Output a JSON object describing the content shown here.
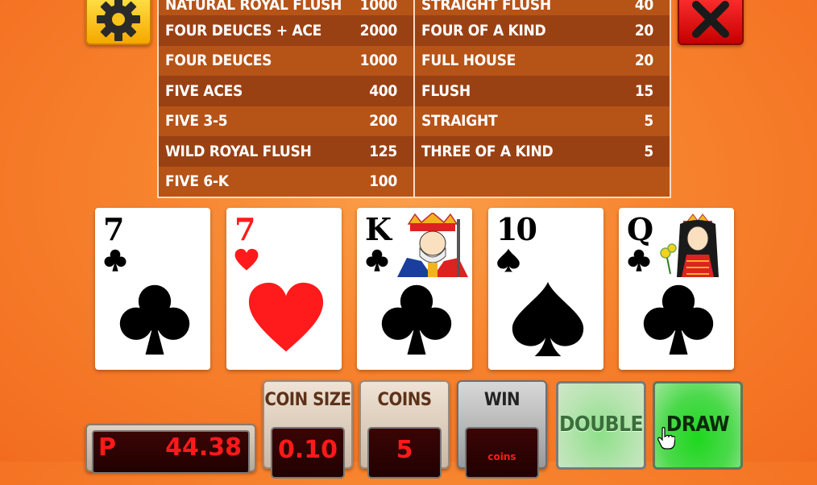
{
  "paytable": {
    "left": [
      {
        "hand": "NATURAL ROYAL FLUSH",
        "pay": "1000"
      },
      {
        "hand": "FOUR DEUCES + ACE",
        "pay": "2000"
      },
      {
        "hand": "FOUR DEUCES",
        "pay": "1000"
      },
      {
        "hand": "FIVE ACES",
        "pay": "400"
      },
      {
        "hand": "FIVE 3-5",
        "pay": "200"
      },
      {
        "hand": "WILD ROYAL FLUSH",
        "pay": "125"
      },
      {
        "hand": "FIVE 6-K",
        "pay": "100"
      }
    ],
    "right": [
      {
        "hand": "STRAIGHT FLUSH",
        "pay": "40"
      },
      {
        "hand": "FOUR OF A KIND",
        "pay": "20"
      },
      {
        "hand": "FULL HOUSE",
        "pay": "20"
      },
      {
        "hand": "FLUSH",
        "pay": "15"
      },
      {
        "hand": "STRAIGHT",
        "pay": "5"
      },
      {
        "hand": "THREE OF A KIND",
        "pay": "5"
      },
      {
        "hand": "",
        "pay": ""
      }
    ]
  },
  "cards": [
    {
      "rank": "7",
      "suit": "clubs",
      "color": "black"
    },
    {
      "rank": "7",
      "suit": "hearts",
      "color": "red"
    },
    {
      "rank": "K",
      "suit": "clubs",
      "color": "black"
    },
    {
      "rank": "10",
      "suit": "spades",
      "color": "black"
    },
    {
      "rank": "Q",
      "suit": "clubs",
      "color": "black"
    }
  ],
  "controls": {
    "credits_prefix": "P",
    "credits_value": "44.38",
    "coin_size_label": "COIN SIZE",
    "coin_size_value": "0.10",
    "coins_label": "COINS",
    "coins_value": "5",
    "win_label": "WIN",
    "win_value": "coins",
    "double_label": "DOUBLE",
    "draw_label": "DRAW"
  },
  "colors": {
    "background": "#f7832e",
    "table_row_light": "#b65317",
    "table_row_dark": "#9a4114",
    "led_red": "#ff1a1a",
    "draw_green": "#2fd42f"
  },
  "icons": {
    "settings": "gear-icon",
    "close": "close-icon"
  }
}
